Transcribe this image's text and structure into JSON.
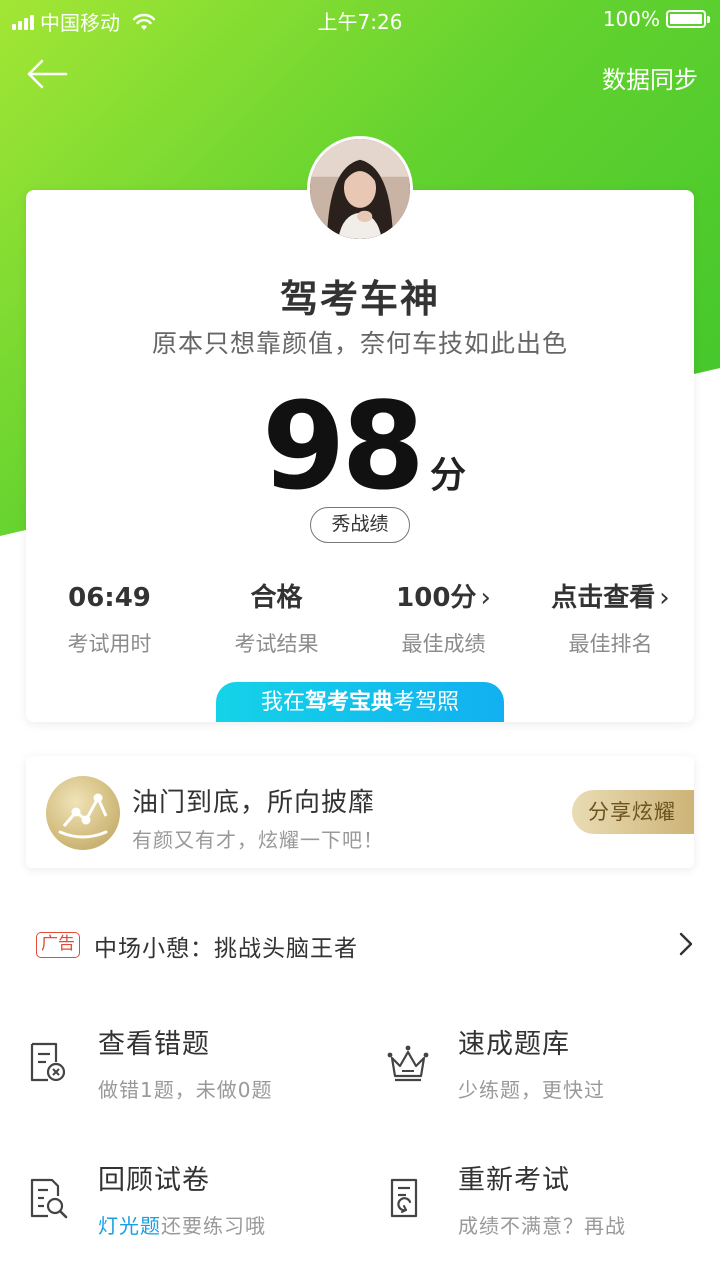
{
  "status_bar": {
    "carrier": "中国移动",
    "time": "上午7:26",
    "battery": "100%"
  },
  "nav": {
    "sync_label": "数据同步"
  },
  "profile": {
    "title": "驾考车神",
    "subtitle": "原本只想靠颜值，奈何车技如此出色",
    "score": "98",
    "score_unit": "分",
    "show_button": "秀战绩"
  },
  "stats": [
    {
      "value": "06:49",
      "label": "考试用时",
      "chevron": false
    },
    {
      "value": "合格",
      "label": "考试结果",
      "chevron": false
    },
    {
      "value": "100分",
      "label": "最佳成绩",
      "chevron": true
    },
    {
      "value": "点击查看",
      "label": "最佳排名",
      "chevron": true
    }
  ],
  "promo_tab": {
    "prefix": "我在",
    "brand": "驾考宝典",
    "suffix": "考驾照"
  },
  "achievement": {
    "title": "油门到底，所向披靡",
    "subtitle": "有颜又有才，炫耀一下吧！",
    "share_button": "分享炫耀"
  },
  "ad": {
    "tag": "广告",
    "text": "中场小憩：挑战头脑王者"
  },
  "actions": [
    {
      "title": "查看错题",
      "subtitle": "做错1题，未做0题",
      "icon": "wrong-questions-icon"
    },
    {
      "title": "速成题库",
      "subtitle": "少练题，更快过",
      "icon": "crown-icon"
    },
    {
      "title": "回顾试卷",
      "subtitle_highlight": "灯光题",
      "subtitle": "还要练习哦",
      "icon": "review-paper-icon"
    },
    {
      "title": "重新考试",
      "subtitle": "成绩不满意？再战",
      "icon": "retake-exam-icon"
    }
  ],
  "colors": {
    "green_start": "#a3e635",
    "green_end": "#3cc42b",
    "promo_blue": "#12b0f0",
    "highlight_blue": "#1a9fe0",
    "ad_red": "#e34b3a",
    "gold": "#cdb377"
  }
}
